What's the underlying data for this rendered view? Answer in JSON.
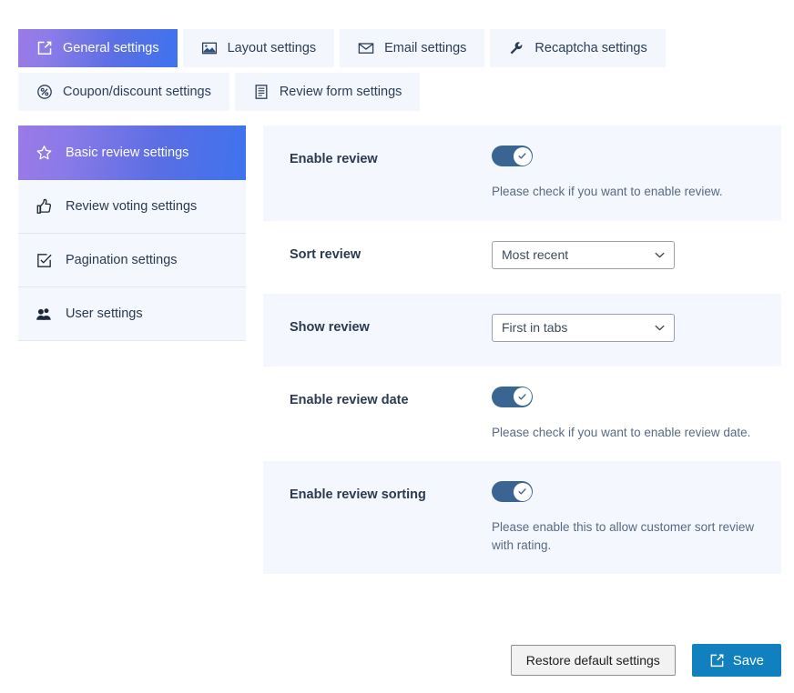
{
  "tabs": [
    {
      "label": "General settings",
      "icon": "edit-square-icon",
      "active": true
    },
    {
      "label": "Layout settings",
      "icon": "image-icon",
      "active": false
    },
    {
      "label": "Email settings",
      "icon": "envelope-icon",
      "active": false
    },
    {
      "label": "Recaptcha settings",
      "icon": "wrench-icon",
      "active": false
    },
    {
      "label": "Coupon/discount settings",
      "icon": "percent-circle-icon",
      "active": false
    },
    {
      "label": "Review form settings",
      "icon": "document-list-icon",
      "active": false
    }
  ],
  "sidebar": {
    "items": [
      {
        "label": "Basic review settings",
        "icon": "star-icon",
        "active": true
      },
      {
        "label": "Review voting settings",
        "icon": "thumbs-up-icon",
        "active": false
      },
      {
        "label": "Pagination settings",
        "icon": "checkbox-icon",
        "active": false
      },
      {
        "label": "User settings",
        "icon": "users-icon",
        "active": false
      }
    ]
  },
  "settings": {
    "rows": [
      {
        "label": "Enable review",
        "type": "toggle",
        "value": "on",
        "helper": "Please check if you want to enable review.",
        "shaded": true
      },
      {
        "label": "Sort review",
        "type": "select",
        "value": "Most recent",
        "options": [
          "Most recent"
        ],
        "helper": "",
        "shaded": false
      },
      {
        "label": "Show review",
        "type": "select",
        "value": "First in tabs",
        "options": [
          "First in tabs"
        ],
        "helper": "",
        "shaded": true
      },
      {
        "label": "Enable review date",
        "type": "toggle",
        "value": "on",
        "helper": "Please check if you want to enable review date.",
        "shaded": false
      },
      {
        "label": "Enable review sorting",
        "type": "toggle",
        "value": "on",
        "helper": "Please enable this to allow customer sort review with rating.",
        "shaded": true
      }
    ]
  },
  "footer": {
    "restore_label": "Restore default settings",
    "save_label": "Save",
    "save_icon": "edit-square-icon"
  },
  "colors": {
    "tab_active_from": "#9b7ae6",
    "tab_active_to": "#3e73ef",
    "tab_inactive_bg": "#f3f6fd",
    "row_shaded_bg": "#f4f7fd",
    "toggle_on": "#3a6592",
    "save_button_bg": "#1180bf",
    "text_primary": "#2b3a4f",
    "text_helper": "#596a80"
  }
}
